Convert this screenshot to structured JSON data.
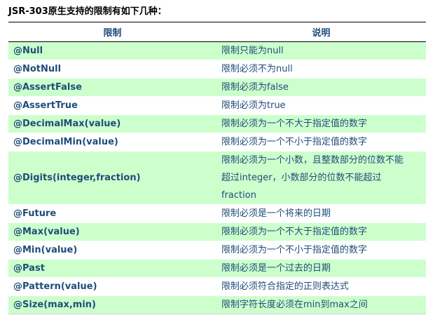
{
  "title": "JSR-303原生支持的限制有如下几种：",
  "columns": [
    "限制",
    "说明"
  ],
  "rows": [
    {
      "name": "@Null",
      "desc": "限制只能为null"
    },
    {
      "name": "@NotNull",
      "desc": "限制必须不为null"
    },
    {
      "name": "@AssertFalse",
      "desc": "限制必须为false"
    },
    {
      "name": "@AssertTrue",
      "desc": "限制必须为true"
    },
    {
      "name": "@DecimalMax(value)",
      "desc": "限制必须为一个不大于指定值的数字"
    },
    {
      "name": "@DecimalMin(value)",
      "desc": "限制必须为一个不小于指定值的数字"
    },
    {
      "name": "@Digits(integer,fraction)",
      "desc": "限制必须为一个小数，且整数部分的位数不能超过integer，小数部分的位数不能超过fraction",
      "desc_lines": [
        "限制必须为一个小数，且整数部分的位数不能",
        "超过integer，小数部分的位数不能超过",
        "fraction"
      ]
    },
    {
      "name": "@Future",
      "desc": "限制必须是一个将来的日期"
    },
    {
      "name": "@Max(value)",
      "desc": "限制必须为一个不大于指定值的数字"
    },
    {
      "name": "@Min(value)",
      "desc": "限制必须为一个不小于指定值的数字"
    },
    {
      "name": "@Past",
      "desc": "限制必须是一个过去的日期"
    },
    {
      "name": "@Pattern(value)",
      "desc": "限制必须符合指定的正则表达式"
    },
    {
      "name": "@Size(max,min)",
      "desc": "限制字符长度必须在min到max之间"
    }
  ]
}
